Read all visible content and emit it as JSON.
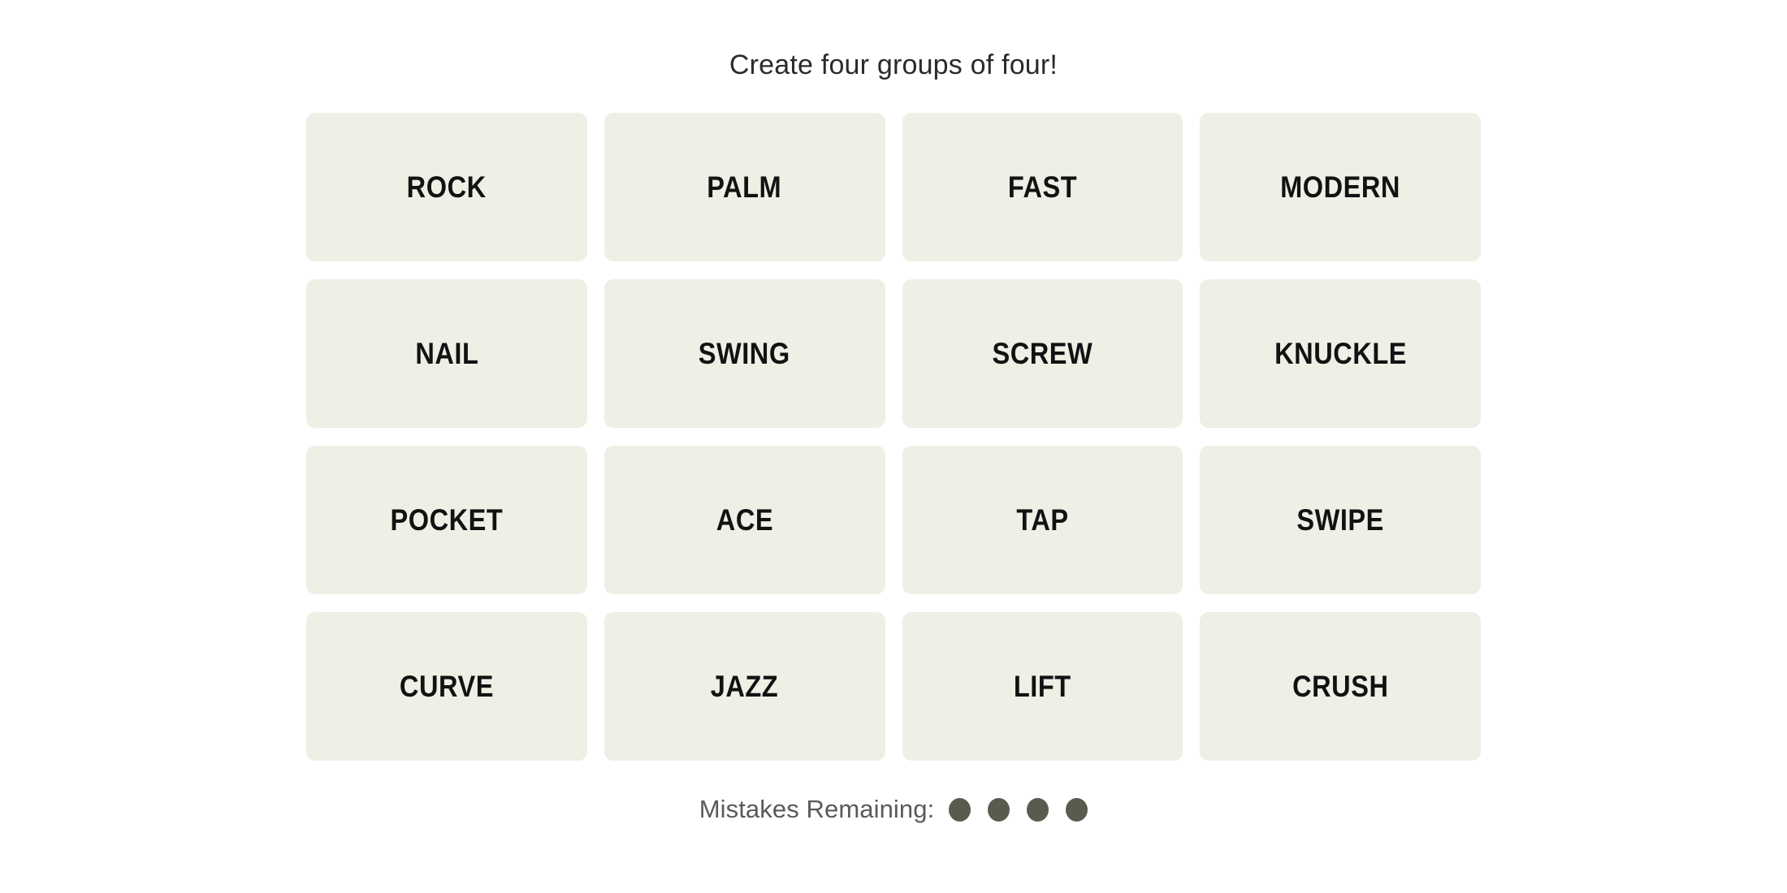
{
  "page": {
    "background_color": "#ffffff"
  },
  "header": {
    "instruction": "Create four groups of four!"
  },
  "board": {
    "rows": 4,
    "columns": 4,
    "tile_background_color": "#EFEFE6",
    "tile_text_color": "#121212",
    "tiles": [
      {
        "label": "ROCK"
      },
      {
        "label": "PALM"
      },
      {
        "label": "FAST"
      },
      {
        "label": "MODERN"
      },
      {
        "label": "NAIL"
      },
      {
        "label": "SWING"
      },
      {
        "label": "SCREW"
      },
      {
        "label": "KNUCKLE"
      },
      {
        "label": "POCKET"
      },
      {
        "label": "ACE"
      },
      {
        "label": "TAP"
      },
      {
        "label": "SWIPE"
      },
      {
        "label": "CURVE"
      },
      {
        "label": "JAZZ"
      },
      {
        "label": "LIFT"
      },
      {
        "label": "CRUSH"
      }
    ]
  },
  "footer": {
    "mistakes_label": "Mistakes Remaining:",
    "mistakes_remaining": 4,
    "dot_color": "#5A5A4E",
    "dots": [
      {
        "name": "mistake-dot-1"
      },
      {
        "name": "mistake-dot-2"
      },
      {
        "name": "mistake-dot-3"
      },
      {
        "name": "mistake-dot-4"
      }
    ]
  }
}
